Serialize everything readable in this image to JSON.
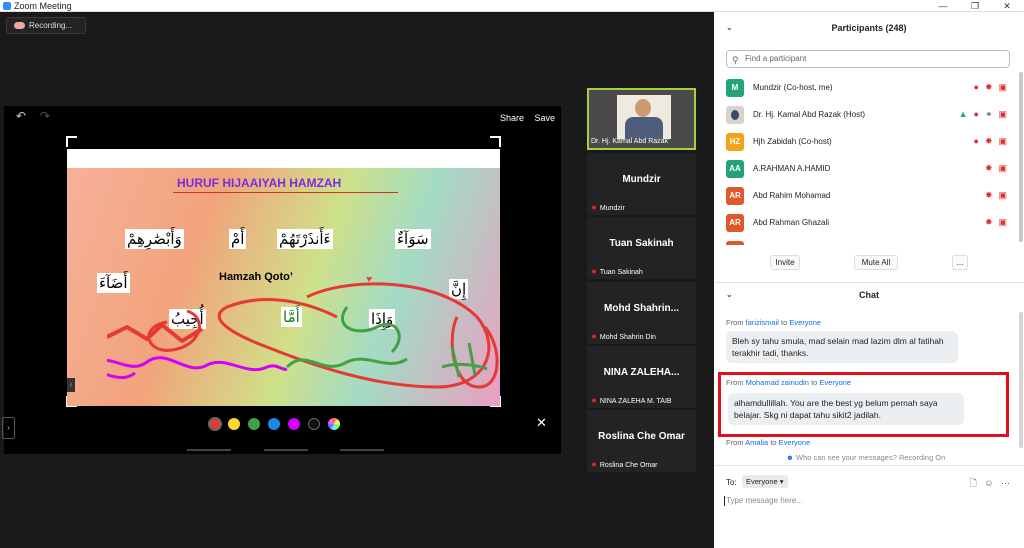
{
  "window": {
    "title": "Zoom Meeting"
  },
  "toolbar": {
    "recording_label": "Recording..."
  },
  "share": {
    "share_link": "Share",
    "save_link": "Save",
    "slide_title": "HURUF HIJAAIYAH HAMZAH",
    "slide_subtitle": "Hamzah Qoto’",
    "arabic": {
      "w1": "سَوَآءٌ",
      "w2": "ءَأَنذَرْتَهُمْ",
      "w3": "أَمْ",
      "w4": "وَأَبْصَٰرِهِمْ",
      "w5": "أَضَآءَ",
      "w6": "إِنَّ",
      "w7": "أُجِيبُ",
      "w8": "أَمَّا",
      "w9": "وَإِذَا",
      "w10": "ءَ"
    },
    "colors": [
      "#e53935",
      "#fdd835",
      "#43a047",
      "#1e88e5",
      "#d500f9",
      "#111111",
      "#cccccc"
    ]
  },
  "gallery": {
    "tiles": [
      {
        "name": "Dr. Hj. Kamal Abd Razak",
        "sub": "Dr. Hj. Kamal Abd Razak"
      },
      {
        "name": "Mundzir",
        "sub": "Mundzir"
      },
      {
        "name": "Tuan Sakinah",
        "sub": "Tuan Sakinah"
      },
      {
        "name": "Mohd Shahrin...",
        "sub": "Mohd Shahrin Din"
      },
      {
        "name": "NINA ZALEHA...",
        "sub": "NINA ZALEHA M. TAIB"
      },
      {
        "name": "Roslina Che Omar",
        "sub": "Roslina Che Omar"
      }
    ]
  },
  "participants": {
    "header": "Participants (248)",
    "search_placeholder": "Find a participant",
    "list": [
      {
        "initials": "M",
        "color": "#23a27c",
        "name": "Mundzir (Co-host, me)"
      },
      {
        "initials": "",
        "color": "#3a4a6a",
        "name": "Dr. Hj. Kamal Abd Razak (Host)"
      },
      {
        "initials": "HZ",
        "color": "#f4a219",
        "name": "Hjh Zabidah (Co-host)"
      },
      {
        "initials": "AA",
        "color": "#23a27c",
        "name": "A.RAHMAN A.HAMID"
      },
      {
        "initials": "AR",
        "color": "#e0572b",
        "name": "Abd Rahim Mohamad"
      },
      {
        "initials": "AR",
        "color": "#e0572b",
        "name": "Abd Rahman Ghazali"
      }
    ],
    "invite_label": "Invite",
    "mute_all_label": "Mute All",
    "more_label": "..."
  },
  "chat": {
    "header": "Chat",
    "messages": [
      {
        "from_prefix": "From",
        "sender": "farizismail",
        "to_word": "to",
        "to": "Everyone",
        "text": "Bleh sy tahu smula, mad selain mad lazim dlm al fatihah terakhir tadi, thanks."
      },
      {
        "from_prefix": "From",
        "sender": "Mohamad zainudin",
        "to_word": "to",
        "to": "Everyone",
        "text": "alhamdullillah. You are the best yg belum pernah saya belajar. Skg ni dapat tahu sikit2 jadilah."
      },
      {
        "from_prefix": "From",
        "sender": "Amalia",
        "to_word": "to",
        "to": "Everyone"
      }
    ],
    "visibility_note": "Who can see your messages? Recording On",
    "to_label": "To:",
    "to_value": "Everyone",
    "input_placeholder": "Type message here..."
  }
}
